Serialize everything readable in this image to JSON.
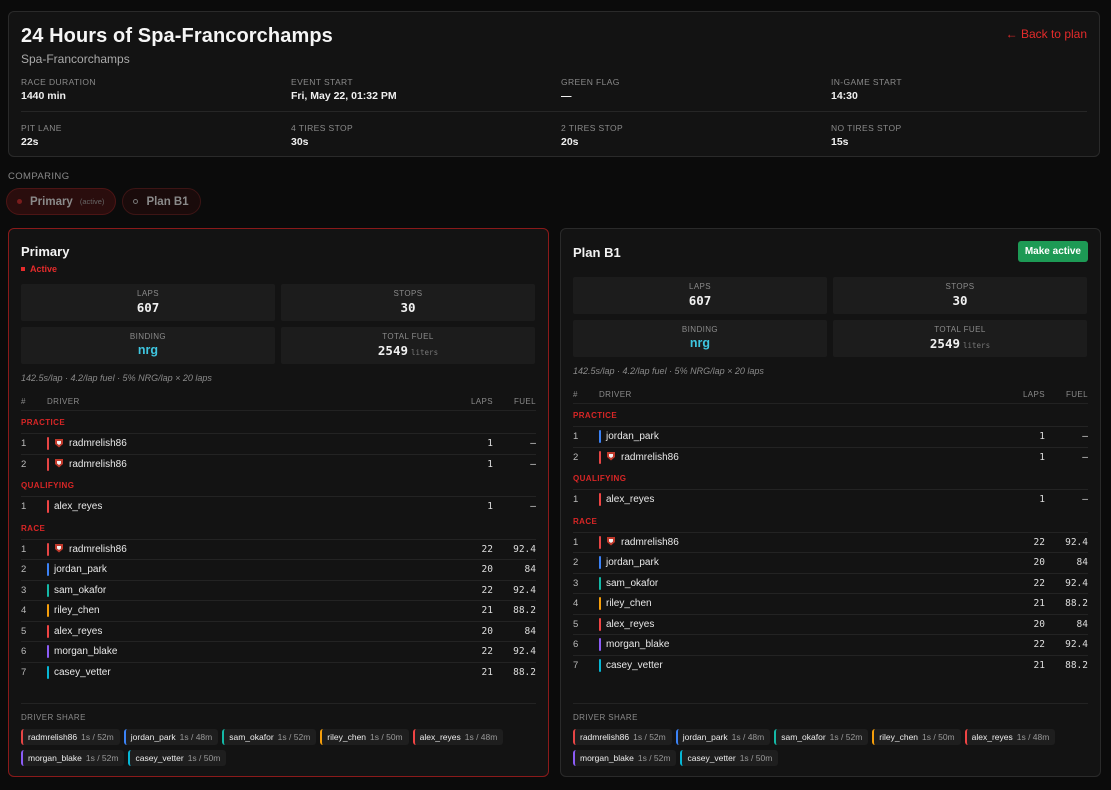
{
  "event": {
    "title": "24 Hours of Spa-Francorchamps",
    "track": "Spa-Francorchamps",
    "back_label": "← Back to plan",
    "meta_row1": [
      {
        "label": "RACE DURATION",
        "value": "1440 min"
      },
      {
        "label": "EVENT START",
        "value": "Fri, May 22, 01:32 PM"
      },
      {
        "label": "GREEN FLAG",
        "value": "—"
      },
      {
        "label": "IN-GAME START",
        "value": "14:30"
      }
    ],
    "meta_row2": [
      {
        "label": "PIT LANE",
        "value": "22s"
      },
      {
        "label": "4 TIRES STOP",
        "value": "30s"
      },
      {
        "label": "2 TIRES STOP",
        "value": "20s"
      },
      {
        "label": "NO TIRES STOP",
        "value": "15s"
      }
    ]
  },
  "comparing": {
    "label": "COMPARING",
    "chips": [
      {
        "label": "Primary",
        "tag": "(active)"
      },
      {
        "label": "Plan B1"
      }
    ]
  },
  "colors": {
    "radmrelish86": "#e64545",
    "jordan_park": "#3b82f6",
    "sam_okafor": "#14b8a6",
    "riley_chen": "#f59e0b",
    "alex_reyes": "#ef4444",
    "morgan_blake": "#8b5cf6",
    "casey_vetter": "#06b6d4",
    "accent": "#e52b2b",
    "make_active": "#1d9a55"
  },
  "plans": [
    {
      "name": "Primary",
      "active_label": "Active",
      "stats": {
        "laps_label": "LAPS",
        "laps": "607",
        "stops_label": "STOPS",
        "stops": "30",
        "binding_label": "BINDING",
        "binding": "nrg",
        "fuel_label": "TOTAL FUEL",
        "fuel": "2549",
        "fuel_unit": "liters"
      },
      "formula": "142.5s/lap · 4.2/lap fuel · 5% NRG/lap × 20 laps",
      "headers": {
        "num": "#",
        "driver": "DRIVER",
        "laps": "LAPS",
        "fuel": "FUEL"
      },
      "sections": [
        {
          "name": "PRACTICE",
          "rows": [
            {
              "n": "1",
              "driver": "radmrelish86",
              "laps": "1",
              "fuel": "–",
              "avatar": true
            },
            {
              "n": "2",
              "driver": "radmrelish86",
              "laps": "1",
              "fuel": "–",
              "avatar": true
            }
          ]
        },
        {
          "name": "QUALIFYING",
          "rows": [
            {
              "n": "1",
              "driver": "alex_reyes",
              "laps": "1",
              "fuel": "–"
            }
          ]
        },
        {
          "name": "RACE",
          "rows": [
            {
              "n": "1",
              "driver": "radmrelish86",
              "laps": "22",
              "fuel": "92.4",
              "avatar": true
            },
            {
              "n": "2",
              "driver": "jordan_park",
              "laps": "20",
              "fuel": "84"
            },
            {
              "n": "3",
              "driver": "sam_okafor",
              "laps": "22",
              "fuel": "92.4"
            },
            {
              "n": "4",
              "driver": "riley_chen",
              "laps": "21",
              "fuel": "88.2"
            },
            {
              "n": "5",
              "driver": "alex_reyes",
              "laps": "20",
              "fuel": "84"
            },
            {
              "n": "6",
              "driver": "morgan_blake",
              "laps": "22",
              "fuel": "92.4"
            },
            {
              "n": "7",
              "driver": "casey_vetter",
              "laps": "21",
              "fuel": "88.2"
            }
          ]
        }
      ],
      "share_label": "DRIVER SHARE",
      "share": [
        {
          "driver": "radmrelish86",
          "dur": "1s / 52m"
        },
        {
          "driver": "jordan_park",
          "dur": "1s / 48m"
        },
        {
          "driver": "sam_okafor",
          "dur": "1s / 52m"
        },
        {
          "driver": "riley_chen",
          "dur": "1s / 50m"
        },
        {
          "driver": "alex_reyes",
          "dur": "1s / 48m"
        },
        {
          "driver": "morgan_blake",
          "dur": "1s / 52m"
        },
        {
          "driver": "casey_vetter",
          "dur": "1s / 50m"
        }
      ]
    },
    {
      "name": "Plan B1",
      "make_active_label": "Make active",
      "stats": {
        "laps_label": "LAPS",
        "laps": "607",
        "stops_label": "STOPS",
        "stops": "30",
        "binding_label": "BINDING",
        "binding": "nrg",
        "fuel_label": "TOTAL FUEL",
        "fuel": "2549",
        "fuel_unit": "liters"
      },
      "formula": "142.5s/lap · 4.2/lap fuel · 5% NRG/lap × 20 laps",
      "headers": {
        "num": "#",
        "driver": "DRIVER",
        "laps": "LAPS",
        "fuel": "FUEL"
      },
      "sections": [
        {
          "name": "PRACTICE",
          "rows": [
            {
              "n": "1",
              "driver": "jordan_park",
              "laps": "1",
              "fuel": "–"
            },
            {
              "n": "2",
              "driver": "radmrelish86",
              "laps": "1",
              "fuel": "–",
              "avatar": true
            }
          ]
        },
        {
          "name": "QUALIFYING",
          "rows": [
            {
              "n": "1",
              "driver": "alex_reyes",
              "laps": "1",
              "fuel": "–"
            }
          ]
        },
        {
          "name": "RACE",
          "rows": [
            {
              "n": "1",
              "driver": "radmrelish86",
              "laps": "22",
              "fuel": "92.4",
              "avatar": true
            },
            {
              "n": "2",
              "driver": "jordan_park",
              "laps": "20",
              "fuel": "84"
            },
            {
              "n": "3",
              "driver": "sam_okafor",
              "laps": "22",
              "fuel": "92.4"
            },
            {
              "n": "4",
              "driver": "riley_chen",
              "laps": "21",
              "fuel": "88.2"
            },
            {
              "n": "5",
              "driver": "alex_reyes",
              "laps": "20",
              "fuel": "84"
            },
            {
              "n": "6",
              "driver": "morgan_blake",
              "laps": "22",
              "fuel": "92.4"
            },
            {
              "n": "7",
              "driver": "casey_vetter",
              "laps": "21",
              "fuel": "88.2"
            }
          ]
        }
      ],
      "share_label": "DRIVER SHARE",
      "share": [
        {
          "driver": "radmrelish86",
          "dur": "1s / 52m"
        },
        {
          "driver": "jordan_park",
          "dur": "1s / 48m"
        },
        {
          "driver": "sam_okafor",
          "dur": "1s / 52m"
        },
        {
          "driver": "riley_chen",
          "dur": "1s / 50m"
        },
        {
          "driver": "alex_reyes",
          "dur": "1s / 48m"
        },
        {
          "driver": "morgan_blake",
          "dur": "1s / 52m"
        },
        {
          "driver": "casey_vetter",
          "dur": "1s / 50m"
        }
      ]
    }
  ]
}
